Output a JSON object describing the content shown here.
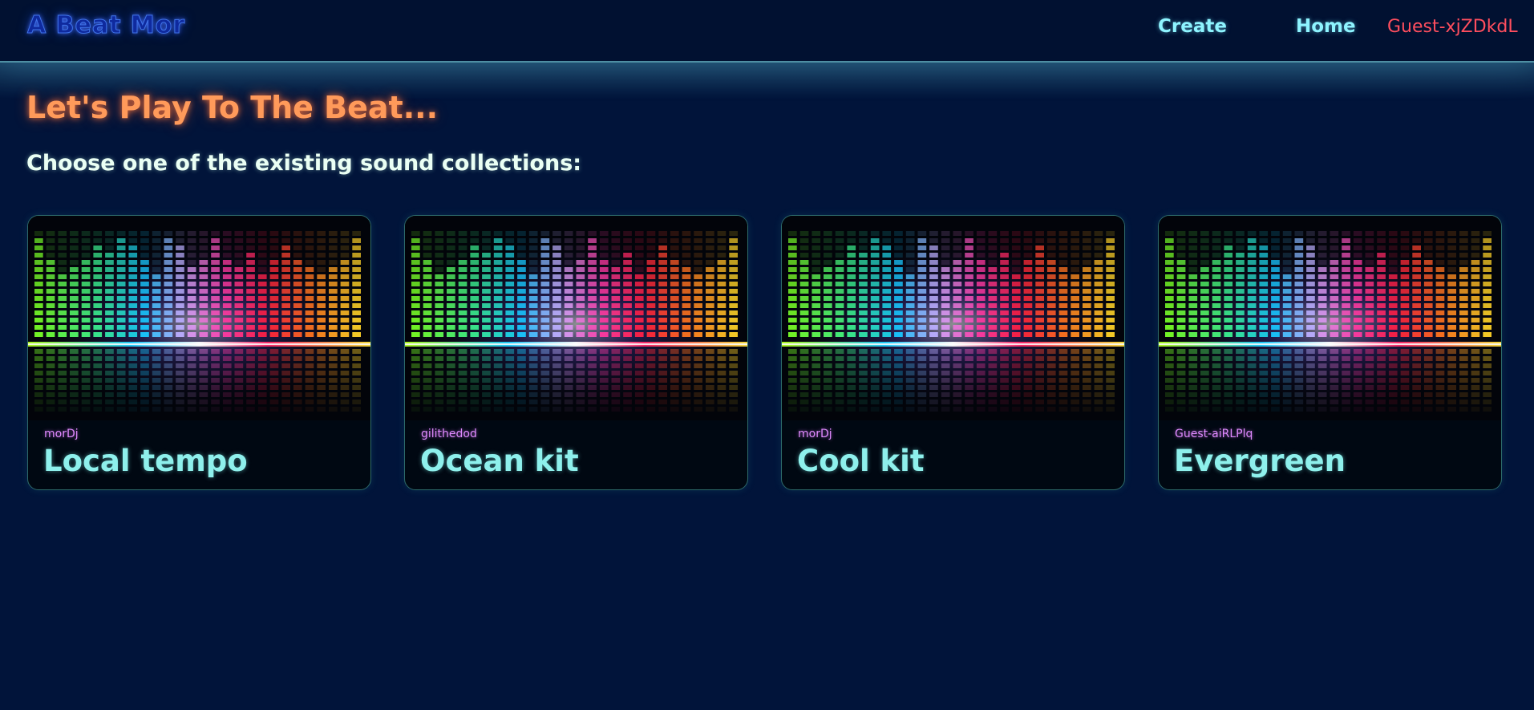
{
  "header": {
    "logo": "A Beat Mor",
    "nav": {
      "create": "Create",
      "home": "Home",
      "user": "Guest-xjZDkdL"
    }
  },
  "main": {
    "heading": "Let's Play To The Beat...",
    "subheading": "Choose one of the existing sound collections:"
  },
  "collections": [
    {
      "author": "morDj",
      "title": "Local tempo"
    },
    {
      "author": "gilithedod",
      "title": "Ocean kit"
    },
    {
      "author": "morDj",
      "title": "Cool kit"
    },
    {
      "author": "Guest-aiRLPlq",
      "title": "Evergreen"
    }
  ],
  "colors": {
    "background": "#01143a",
    "header_background": "#011131",
    "logo": "#0f2a9e",
    "nav_link": "#8ef4ff",
    "user_name": "#ff4e5e",
    "heading": "#ff9a5a",
    "subheading": "#eafff4",
    "card_author": "#e08aff",
    "card_title": "#8ef0ec"
  }
}
